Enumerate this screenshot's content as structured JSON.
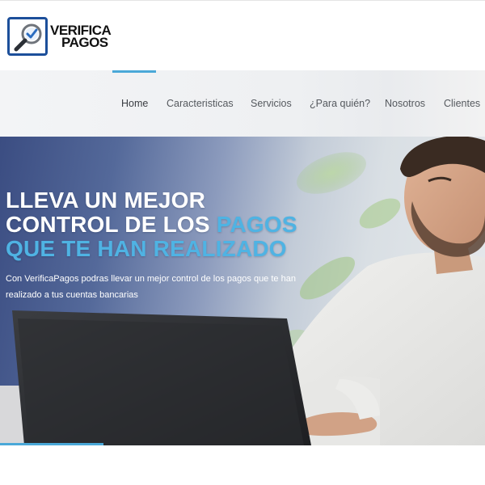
{
  "brand": {
    "line1": "VERIFICA",
    "line2": "PAGOS",
    "icon": "magnifier-check-icon",
    "colors": {
      "frame": "#1c4f9a",
      "check": "#2a6cc0"
    }
  },
  "nav": {
    "items": [
      {
        "label": "Home",
        "active": true
      },
      {
        "label": "Caracteristicas"
      },
      {
        "label": "Servicios"
      },
      {
        "label": "¿Para quién?"
      },
      {
        "label": "Nosotros"
      },
      {
        "label": "Clientes"
      }
    ],
    "active_color": "#4aa8d8"
  },
  "hero": {
    "title_line1": "LLEVA UN MEJOR",
    "title_line2_a": "CONTROL DE LOS ",
    "title_line2_b": "PAGOS",
    "title_line3_a": "QUE TE HAN ",
    "title_line3_b": "REALIZADO",
    "subtitle": "Con VerificaPagos podras llevar un mejor control de los pagos que te han realizado a tus cuentas bancarias",
    "accent_color": "#4fb3e3"
  }
}
